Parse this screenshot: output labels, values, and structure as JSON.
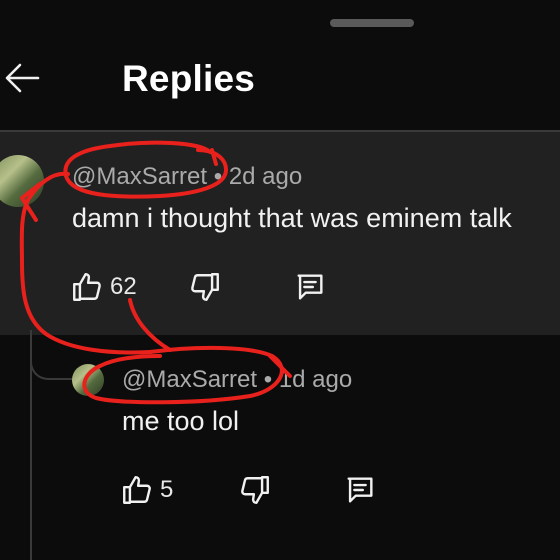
{
  "header": {
    "title": "Replies"
  },
  "parent_comment": {
    "author": "@MaxSarret",
    "separator": " • ",
    "time": "2d ago",
    "text": "damn i thought that was eminem talk",
    "likes": "62"
  },
  "reply": {
    "author": "@MaxSarret",
    "separator": " • ",
    "time": "1d ago",
    "text": "me too lol",
    "likes": "5"
  },
  "annotation_color": "#e8211c"
}
